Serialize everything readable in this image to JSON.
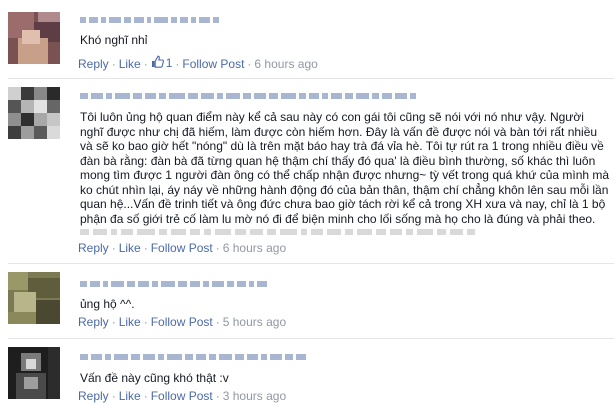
{
  "colors": {
    "link": "#4b6aa7",
    "meta": "#9197a3",
    "text": "#141823",
    "divider": "#e5e5e5"
  },
  "comments": [
    {
      "text": "Khó nghĩ nhỉ",
      "actions": {
        "reply": "Reply",
        "like": "Like",
        "like_count": "1",
        "follow": "Follow Post",
        "time": "6 hours ago"
      }
    },
    {
      "text": "Tôi luôn ủng hộ quan điểm này kể cả sau này có con gái tôi cũng sẽ nói với nó như vậy. Người nghĩ được như chị đã hiếm, làm được còn hiếm hơn. Đây là vấn đề được nói và bàn tới rất nhiều và sẽ ko bao giờ hết \"nóng\" dù là trên mặt báo hay trà đá vỉa hè. Tôi tự rút ra 1 trong nhiều điều về đàn bà rằng: đàn bà đã từng quan hệ thậm chí thấy đó qua' là điều bình thường, số khác thì luôn mong tìm được 1 người đàn ông có thể chấp nhận được nhưng~ tỳ vết trong quá khứ của mình mà ko chút nhìn lại, áy náy về những hành động đó của bản thân, thậm chí chẳng khôn lên sau mỗi lần quan hệ...Vấn đề trinh tiết và ông đức chưa bao giờ tách rời kể cả trong XH xưa và nay, chỉ là 1 bộ phận đa số giới trẻ cố làm lu mờ nó đi để biện minh cho lối sống mà họ cho là đúng và phải theo.",
      "actions": {
        "reply": "Reply",
        "like": "Like",
        "follow": "Follow Post",
        "time": "6 hours ago"
      }
    },
    {
      "text": "ủng hộ ^^.",
      "actions": {
        "reply": "Reply",
        "like": "Like",
        "follow": "Follow Post",
        "time": "5 hours ago"
      }
    },
    {
      "text": "Vấn đề này cũng khó thật :v",
      "actions": {
        "reply": "Reply",
        "like": "Like",
        "follow": "Follow Post",
        "time": "3 hours ago"
      }
    }
  ]
}
